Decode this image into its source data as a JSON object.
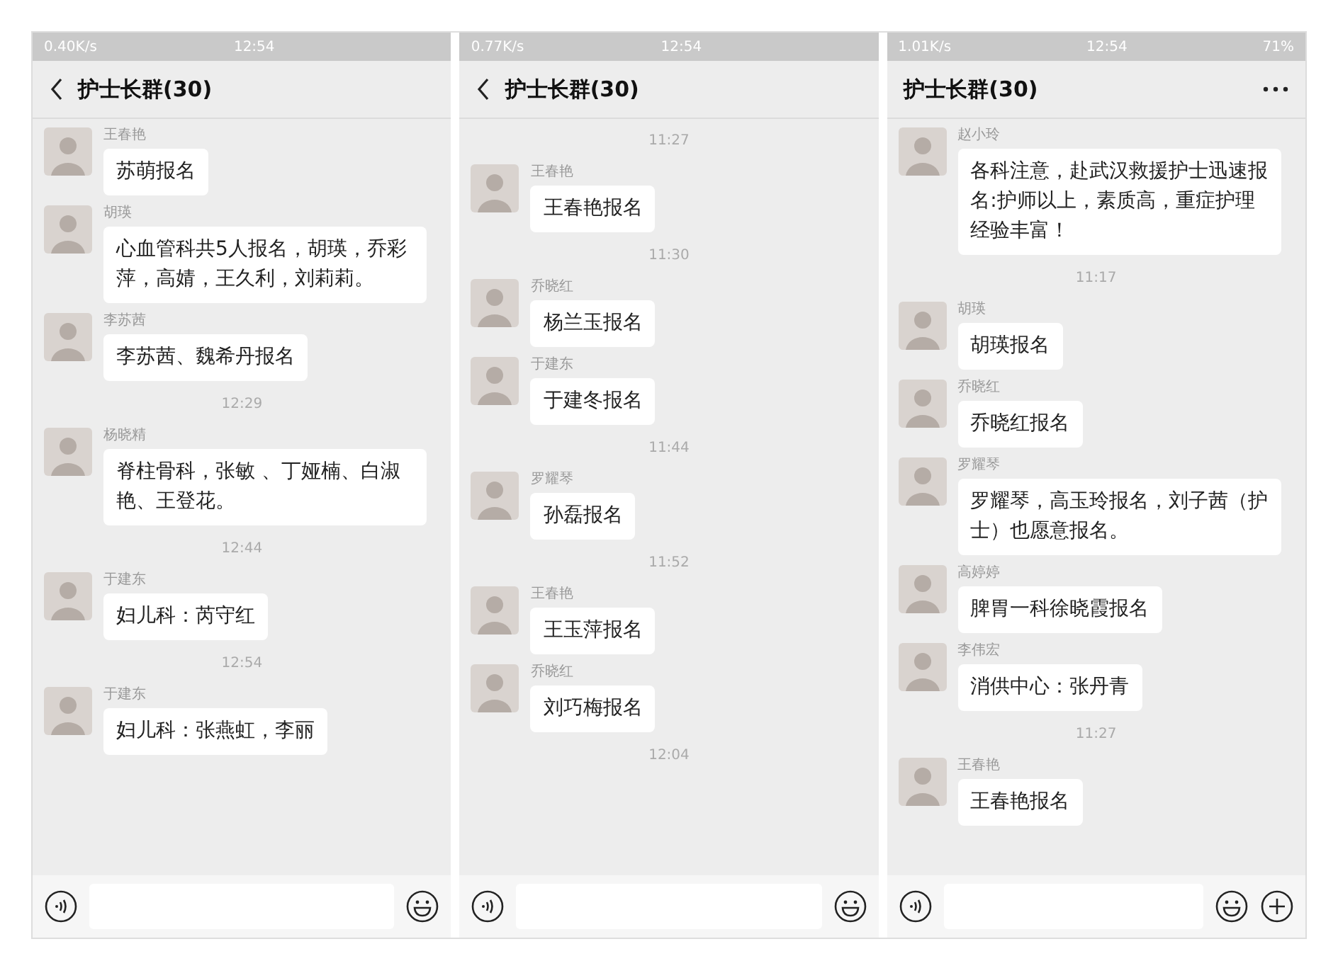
{
  "panels": [
    {
      "status_bar": {
        "speed": "0.40K/s",
        "time": "12:54"
      },
      "header": {
        "title": "护士长群(30)",
        "back": true,
        "more": false
      },
      "messages": [
        {
          "kind": "message",
          "sender": "王春艳",
          "text": "苏萌报名"
        },
        {
          "kind": "message",
          "sender": "胡瑛",
          "text": "心血管科共5人报名，胡瑛，乔彩萍，高婧，王久利，刘莉莉。"
        },
        {
          "kind": "message",
          "sender": "李苏茜",
          "text": "李苏茜、魏希丹报名"
        },
        {
          "kind": "time",
          "text": "12:29"
        },
        {
          "kind": "message",
          "sender": "杨晓精",
          "text": "脊柱骨科，张敏 、丁娅楠、白淑艳、王登花。"
        },
        {
          "kind": "time",
          "text": "12:44"
        },
        {
          "kind": "message",
          "sender": "于建东",
          "text": "妇儿科：芮守红"
        },
        {
          "kind": "time",
          "text": "12:54"
        },
        {
          "kind": "message",
          "sender": "于建东",
          "text": "妇儿科：张燕虹，李丽"
        }
      ],
      "input_bar": {
        "plus": false
      }
    },
    {
      "status_bar": {
        "speed": "0.77K/s",
        "time": "12:54"
      },
      "header": {
        "title": "护士长群(30)",
        "back": true,
        "more": false
      },
      "messages": [
        {
          "kind": "time",
          "text": "11:27"
        },
        {
          "kind": "message",
          "sender": "王春艳",
          "text": "王春艳报名"
        },
        {
          "kind": "time",
          "text": "11:30"
        },
        {
          "kind": "message",
          "sender": "乔晓红",
          "text": "杨兰玉报名"
        },
        {
          "kind": "message",
          "sender": "于建东",
          "text": "于建冬报名"
        },
        {
          "kind": "time",
          "text": "11:44"
        },
        {
          "kind": "message",
          "sender": "罗耀琴",
          "text": "孙磊报名"
        },
        {
          "kind": "time",
          "text": "11:52"
        },
        {
          "kind": "message",
          "sender": "王春艳",
          "text": "王玉萍报名"
        },
        {
          "kind": "message",
          "sender": "乔晓红",
          "text": "刘巧梅报名"
        },
        {
          "kind": "time",
          "text": "12:04"
        }
      ],
      "input_bar": {
        "plus": false
      }
    },
    {
      "status_bar": {
        "speed": "1.01K/s",
        "time": "12:54",
        "battery": "71%"
      },
      "header": {
        "title": "护士长群(30)",
        "back": false,
        "more": true
      },
      "messages": [
        {
          "kind": "message",
          "sender": "赵小玲",
          "text": "各科注意，赴武汉救援护士迅速报名:护师以上，素质高，重症护理经验丰富！"
        },
        {
          "kind": "time",
          "text": "11:17"
        },
        {
          "kind": "message",
          "sender": "胡瑛",
          "text": "胡瑛报名"
        },
        {
          "kind": "message",
          "sender": "乔晓红",
          "text": "乔晓红报名"
        },
        {
          "kind": "message",
          "sender": "罗耀琴",
          "text": "罗耀琴，高玉玲报名，刘子茜（护士）也愿意报名。"
        },
        {
          "kind": "message",
          "sender": "高婷婷",
          "text": "脾胃一科徐晓霞报名"
        },
        {
          "kind": "message",
          "sender": "李伟宏",
          "text": "消供中心：张丹青"
        },
        {
          "kind": "time",
          "text": "11:27"
        },
        {
          "kind": "message",
          "sender": "王春艳",
          "text": "王春艳报名"
        }
      ],
      "input_bar": {
        "plus": true
      }
    }
  ]
}
